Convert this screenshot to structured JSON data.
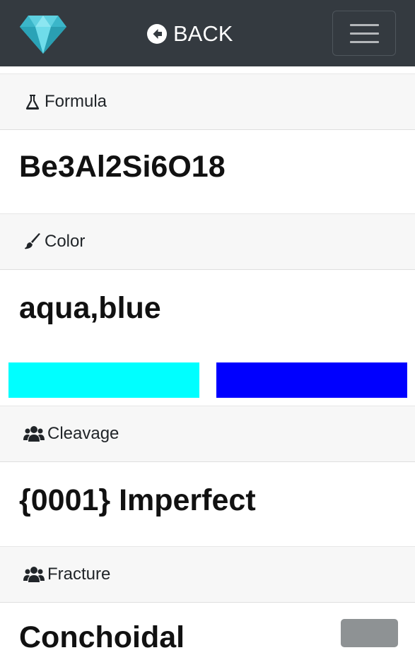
{
  "navbar": {
    "logo_icon": "diamond-icon",
    "back_label": "BACK",
    "back_icon": "arrow-circle-left-icon",
    "menu_icon": "hamburger-icon"
  },
  "sections": {
    "formula": {
      "label": "Formula",
      "icon": "flask-icon",
      "value": "Be3Al2Si6O18"
    },
    "color": {
      "label": "Color",
      "icon": "paint-brush-icon",
      "value": "aqua,blue",
      "swatches": [
        "#00ffff",
        "#0000ff"
      ]
    },
    "cleavage": {
      "label": "Cleavage",
      "icon": "users-icon",
      "value": "{0001} Imperfect"
    },
    "fracture": {
      "label": "Fracture",
      "icon": "users-icon",
      "value": "Conchoidal"
    }
  }
}
